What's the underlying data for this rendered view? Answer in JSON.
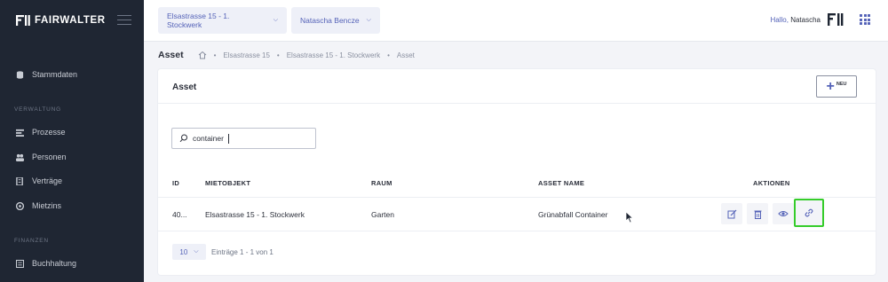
{
  "brand": {
    "name": "FAIRWALTER"
  },
  "sidebar": {
    "items": [
      {
        "label": "Stammdaten",
        "icon": "database-icon"
      },
      {
        "label": "Prozesse",
        "icon": "process-icon"
      },
      {
        "label": "Personen",
        "icon": "people-icon"
      },
      {
        "label": "Verträge",
        "icon": "contract-icon"
      },
      {
        "label": "Mietzins",
        "icon": "coins-icon"
      },
      {
        "label": "Buchhaltung",
        "icon": "ledger-icon"
      }
    ],
    "sections": {
      "verwaltung": "VERWALTUNG",
      "finanzen": "FINANZEN"
    }
  },
  "header": {
    "property_select": "Elsastrasse 15 - 1. Stockwerk",
    "person_select": "Natascha Bencze",
    "greeting": "Hallo,",
    "user_name": "Natascha"
  },
  "breadcrumb": {
    "title": "Asset",
    "path": [
      "Elsastrasse 15",
      "Elsastrasse 15 - 1. Stockwerk",
      "Asset"
    ],
    "separator": "•"
  },
  "card": {
    "title": "Asset",
    "new_button": "NEU",
    "search_value": "container"
  },
  "table": {
    "columns": [
      "ID",
      "MIETOBJEKT",
      "RAUM",
      "ASSET NAME",
      "AKTIONEN"
    ],
    "rows": [
      {
        "id": "40...",
        "mietobjekt": "Elsastrasse 15 - 1. Stockwerk",
        "raum": "Garten",
        "asset_name": "Grünabfall Container"
      }
    ],
    "actions": [
      "edit-icon",
      "delete-icon",
      "view-icon",
      "link-icon"
    ]
  },
  "pagination": {
    "page_size": "10",
    "entries_text": "Einträge 1 - 1 von 1"
  },
  "colors": {
    "accent": "#5563b8",
    "sidebar": "#1f2633",
    "highlight": "#35cc2a"
  }
}
